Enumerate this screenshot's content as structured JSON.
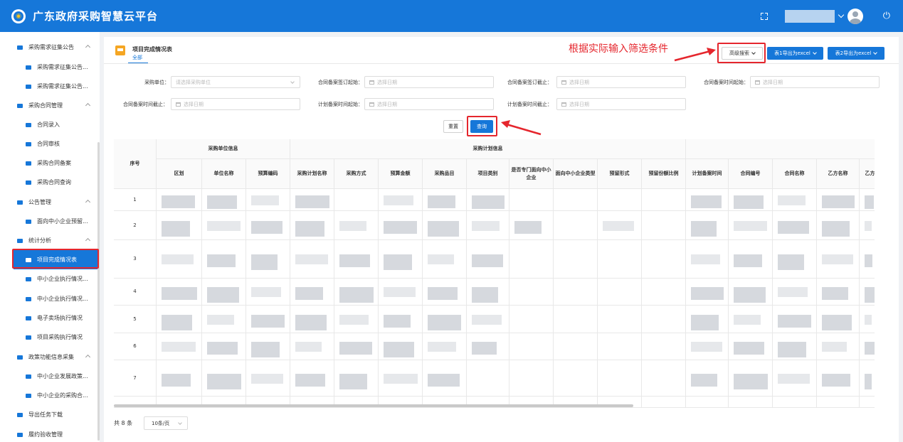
{
  "header": {
    "title": "广东政府采购智慧云平台",
    "logo_glyph": "◉"
  },
  "sidebar": {
    "items": [
      {
        "label": "采购需求征集公告",
        "level": "group",
        "caret": true
      },
      {
        "label": "采购需求征集公告...",
        "level": "child"
      },
      {
        "label": "采购需求征集公告...",
        "level": "child"
      },
      {
        "label": "采购合同管理",
        "level": "group",
        "caret": true
      },
      {
        "label": "合同录入",
        "level": "child"
      },
      {
        "label": "合同审核",
        "level": "child"
      },
      {
        "label": "采购合同备案",
        "level": "child"
      },
      {
        "label": "采购合同查询",
        "level": "child"
      },
      {
        "label": "公告管理",
        "level": "group",
        "caret": true
      },
      {
        "label": "面向中小企业预留...",
        "level": "child"
      },
      {
        "label": "统计分析",
        "level": "group",
        "caret": true
      },
      {
        "label": "项目完成情况表",
        "level": "child",
        "active": true
      },
      {
        "label": "中小企业执行情况...",
        "level": "child"
      },
      {
        "label": "中小企业执行情况...",
        "level": "child"
      },
      {
        "label": "电子卖场执行情况",
        "level": "child"
      },
      {
        "label": "项目采购执行情况",
        "level": "child"
      },
      {
        "label": "政策功能信息采集",
        "level": "group",
        "caret": true
      },
      {
        "label": "中小企业发展政策...",
        "level": "child"
      },
      {
        "label": "中小企业的采购合...",
        "level": "child"
      },
      {
        "label": "导出任务下载",
        "level": "group"
      },
      {
        "label": "履约验收管理",
        "level": "group"
      }
    ]
  },
  "panel": {
    "title": "项目完成情况表",
    "subtitle": "全部",
    "annotation": "根据实际输入筛选条件",
    "buttons": {
      "advanced_search": "高级搜索",
      "export1": "表1导出为excel",
      "export2": "表2导出为excel",
      "reset": "重置",
      "query": "查询"
    },
    "filters": [
      {
        "label": "采购单位：",
        "placeholder": "请选择采购单位",
        "type": "select"
      },
      {
        "label": "合同备案签订起始：",
        "placeholder": "选择日期",
        "type": "date"
      },
      {
        "label": "合同备案签订截止：",
        "placeholder": "选择日期",
        "type": "date"
      },
      {
        "label": "合同备案时间起始：",
        "placeholder": "选择日期",
        "type": "date"
      },
      {
        "label": "合同备案时间截止：",
        "placeholder": "选择日期",
        "type": "date"
      },
      {
        "label": "计划备案时间起始：",
        "placeholder": "选择日期",
        "type": "date"
      },
      {
        "label": "计划备案时间截止：",
        "placeholder": "选择日期",
        "type": "date"
      }
    ]
  },
  "table": {
    "seq_header": "序号",
    "group_headers": [
      "采购单位信息",
      "采购计划信息"
    ],
    "columns": [
      "区划",
      "单位名称",
      "预算编码",
      "采购计划名称",
      "采购方式",
      "预算金额",
      "采购品目",
      "项目类别",
      "是否专门面向中小企业",
      "面向中小企业类型",
      "预留形式",
      "预留份额比例",
      "计划备案时间",
      "合同编号",
      "合同名称",
      "乙方名称",
      "乙方"
    ],
    "rows": [
      "1",
      "2",
      "3",
      "4",
      "5",
      "6",
      "7"
    ]
  },
  "pagination": {
    "total": "共 8 条",
    "page_size": "10条/页"
  },
  "colors": {
    "brand": "#1677d9",
    "highlight": "#e5262d"
  }
}
